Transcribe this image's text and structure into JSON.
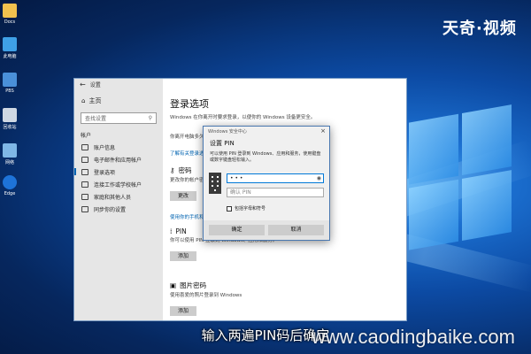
{
  "brand": "天奇·视频",
  "desktop_icons": [
    {
      "label": "Docs",
      "color": "#f2c14e"
    },
    {
      "label": "此电脑",
      "color": "#3fa0e6"
    },
    {
      "label": "PBS",
      "color": "#4a90d9"
    },
    {
      "label": "回收站",
      "color": "#cfd8e3"
    },
    {
      "label": "网络",
      "color": "#7fb7e6"
    },
    {
      "label": "Edge",
      "color": "#1e73d8"
    }
  ],
  "settings": {
    "title": "设置",
    "home": "主页",
    "search_placeholder": "查找设置",
    "section": "帐户",
    "nav": [
      "账户信息",
      "电子邮件和应用帐户",
      "登录选项",
      "连接工作或学校帐户",
      "家庭和其他人员",
      "同步你的设置"
    ],
    "page_title": "登录选项",
    "intro": "Windows 在你离开时要求登录，以便你的 Windows 设备更安全。",
    "require_label": "你离开电脑多久后需要重新登录?",
    "link1": "了解有关登录选项的更多信息",
    "password_title": "密码",
    "password_text": "更改你的帐户密码",
    "password_button": "更改",
    "link2": "使用你的手机和其他设备",
    "pin_title": "PIN",
    "pin_text": "你可以使用 PIN 登录到 Windows、应用和服务。",
    "pin_button": "添加",
    "picture_title": "图片密码",
    "picture_text": "使用喜爱的照片登录到 Windows",
    "picture_button": "添加"
  },
  "dialog": {
    "titlebar": "Windows 安全中心",
    "heading": "设置 PIN",
    "description": "可以使用 PIN 登录到 Windows、应用和服务，使用键盘或数字键盘轻松输入。",
    "pin_value": "• • •",
    "confirm_placeholder": "确认 PIN",
    "checkbox_label": "包括字母和符号",
    "ok": "确定",
    "cancel": "取消"
  },
  "caption": "输入两遍PIN码后确定",
  "watermark": "www.caodingbaike.com"
}
